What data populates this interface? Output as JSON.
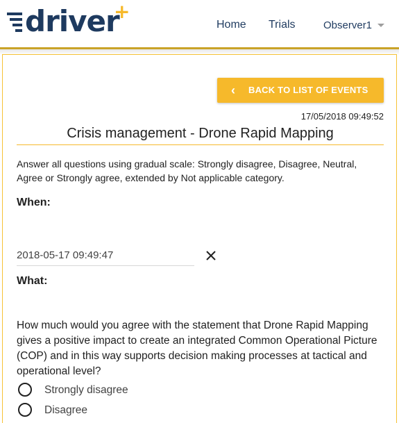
{
  "header": {
    "logo_text": "driver",
    "logo_plus": "+",
    "nav": {
      "home": "Home",
      "trials": "Trials",
      "user": "Observer1"
    }
  },
  "colors": {
    "brand_navy": "#1e3a5f",
    "accent_yellow": "#f6b92b",
    "header_rule": "#c9a227"
  },
  "actions": {
    "back_label": "BACK TO LIST OF EVENTS",
    "back_icon": "chevron-left-icon"
  },
  "event": {
    "timestamp": "17/05/2018 09:49:52",
    "title": "Crisis management - Drone Rapid Mapping"
  },
  "form": {
    "instructions": "Answer all questions using gradual scale: Strongly disagree, Disagree, Neutral, Agree or Strongly agree, extended by Not applicable category.",
    "when_label": "When:",
    "when_value": "2018-05-17 09:49:47",
    "clear_icon": "close-icon",
    "what_label": "What:",
    "question": "How much would you agree with the statement that Drone Rapid Mapping gives a positive impact to create an integrated Common Operational Picture (COP) and in this way supports decision making processes at tactical and operational level?",
    "options": [
      "Strongly disagree",
      "Disagree"
    ]
  }
}
